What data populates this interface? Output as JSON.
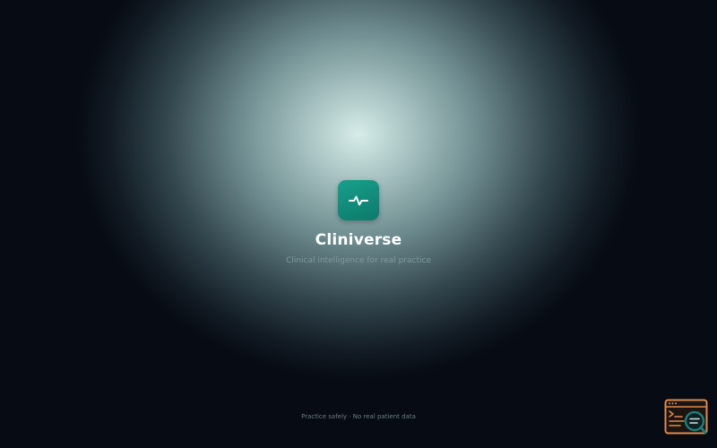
{
  "app": {
    "name": "Cliniverse",
    "tagline": "Clinical intelligence for real practice",
    "logo_icon": "pulse-icon",
    "brand_color": "#12907e"
  },
  "footer": {
    "note": "Practice safely · No real patient data"
  },
  "corner_widget": {
    "icon": "terminal-search-icon",
    "accent_color": "#e08a4a",
    "secondary_color": "#1f7d78"
  },
  "colors": {
    "background": "#070b13",
    "glow": "#d6ece9",
    "title": "#ffffff",
    "tagline": "#7f99a0"
  }
}
